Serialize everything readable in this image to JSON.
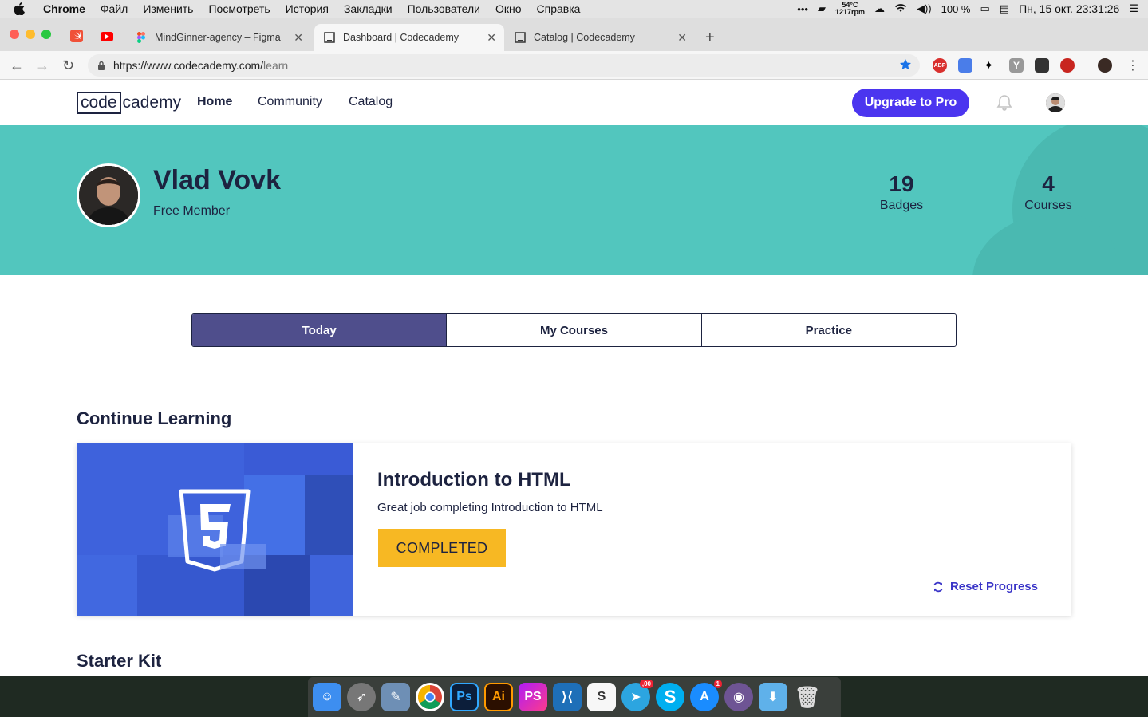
{
  "menubar": {
    "app": "Chrome",
    "items": [
      "Файл",
      "Изменить",
      "Посмотреть",
      "История",
      "Закладки",
      "Пользователи",
      "Окно",
      "Справка"
    ],
    "temp": "54°C",
    "rpm": "1217rpm",
    "battery": "100 %",
    "datetime": "Пн, 15 окт.  23:31:26"
  },
  "tabs": [
    {
      "title": "MindGinner-agency – Figma"
    },
    {
      "title": "Dashboard | Codecademy"
    },
    {
      "title": "Catalog | Codecademy"
    }
  ],
  "address": {
    "host": "https://www.codecademy.com/",
    "path": "learn"
  },
  "nav": {
    "logo_box": "code",
    "logo_rest": "cademy",
    "links": [
      "Home",
      "Community",
      "Catalog"
    ],
    "upgrade": "Upgrade to Pro"
  },
  "profile": {
    "name": "Vlad Vovk",
    "membership": "Free Member",
    "badges_count": "19",
    "badges_label": "Badges",
    "courses_count": "4",
    "courses_label": "Courses"
  },
  "segments": [
    "Today",
    "My Courses",
    "Practice"
  ],
  "continue": {
    "heading": "Continue Learning",
    "course_title": "Introduction to HTML",
    "course_desc": "Great job completing Introduction to HTML",
    "status": "COMPLETED",
    "reset": "Reset Progress"
  },
  "starter": {
    "heading": "Starter Kit"
  },
  "colors": {
    "accent": "#4b35ef",
    "hero": "#52c6be",
    "completed": "#f7b823",
    "tab_active": "#4f4e8c"
  },
  "dock": {
    "telegram_badge": ",00",
    "appstore_badge": "1",
    "ps_label": "Ps",
    "ai_label": "Ai",
    "phpstorm_label": "PS",
    "s_label": "S"
  }
}
